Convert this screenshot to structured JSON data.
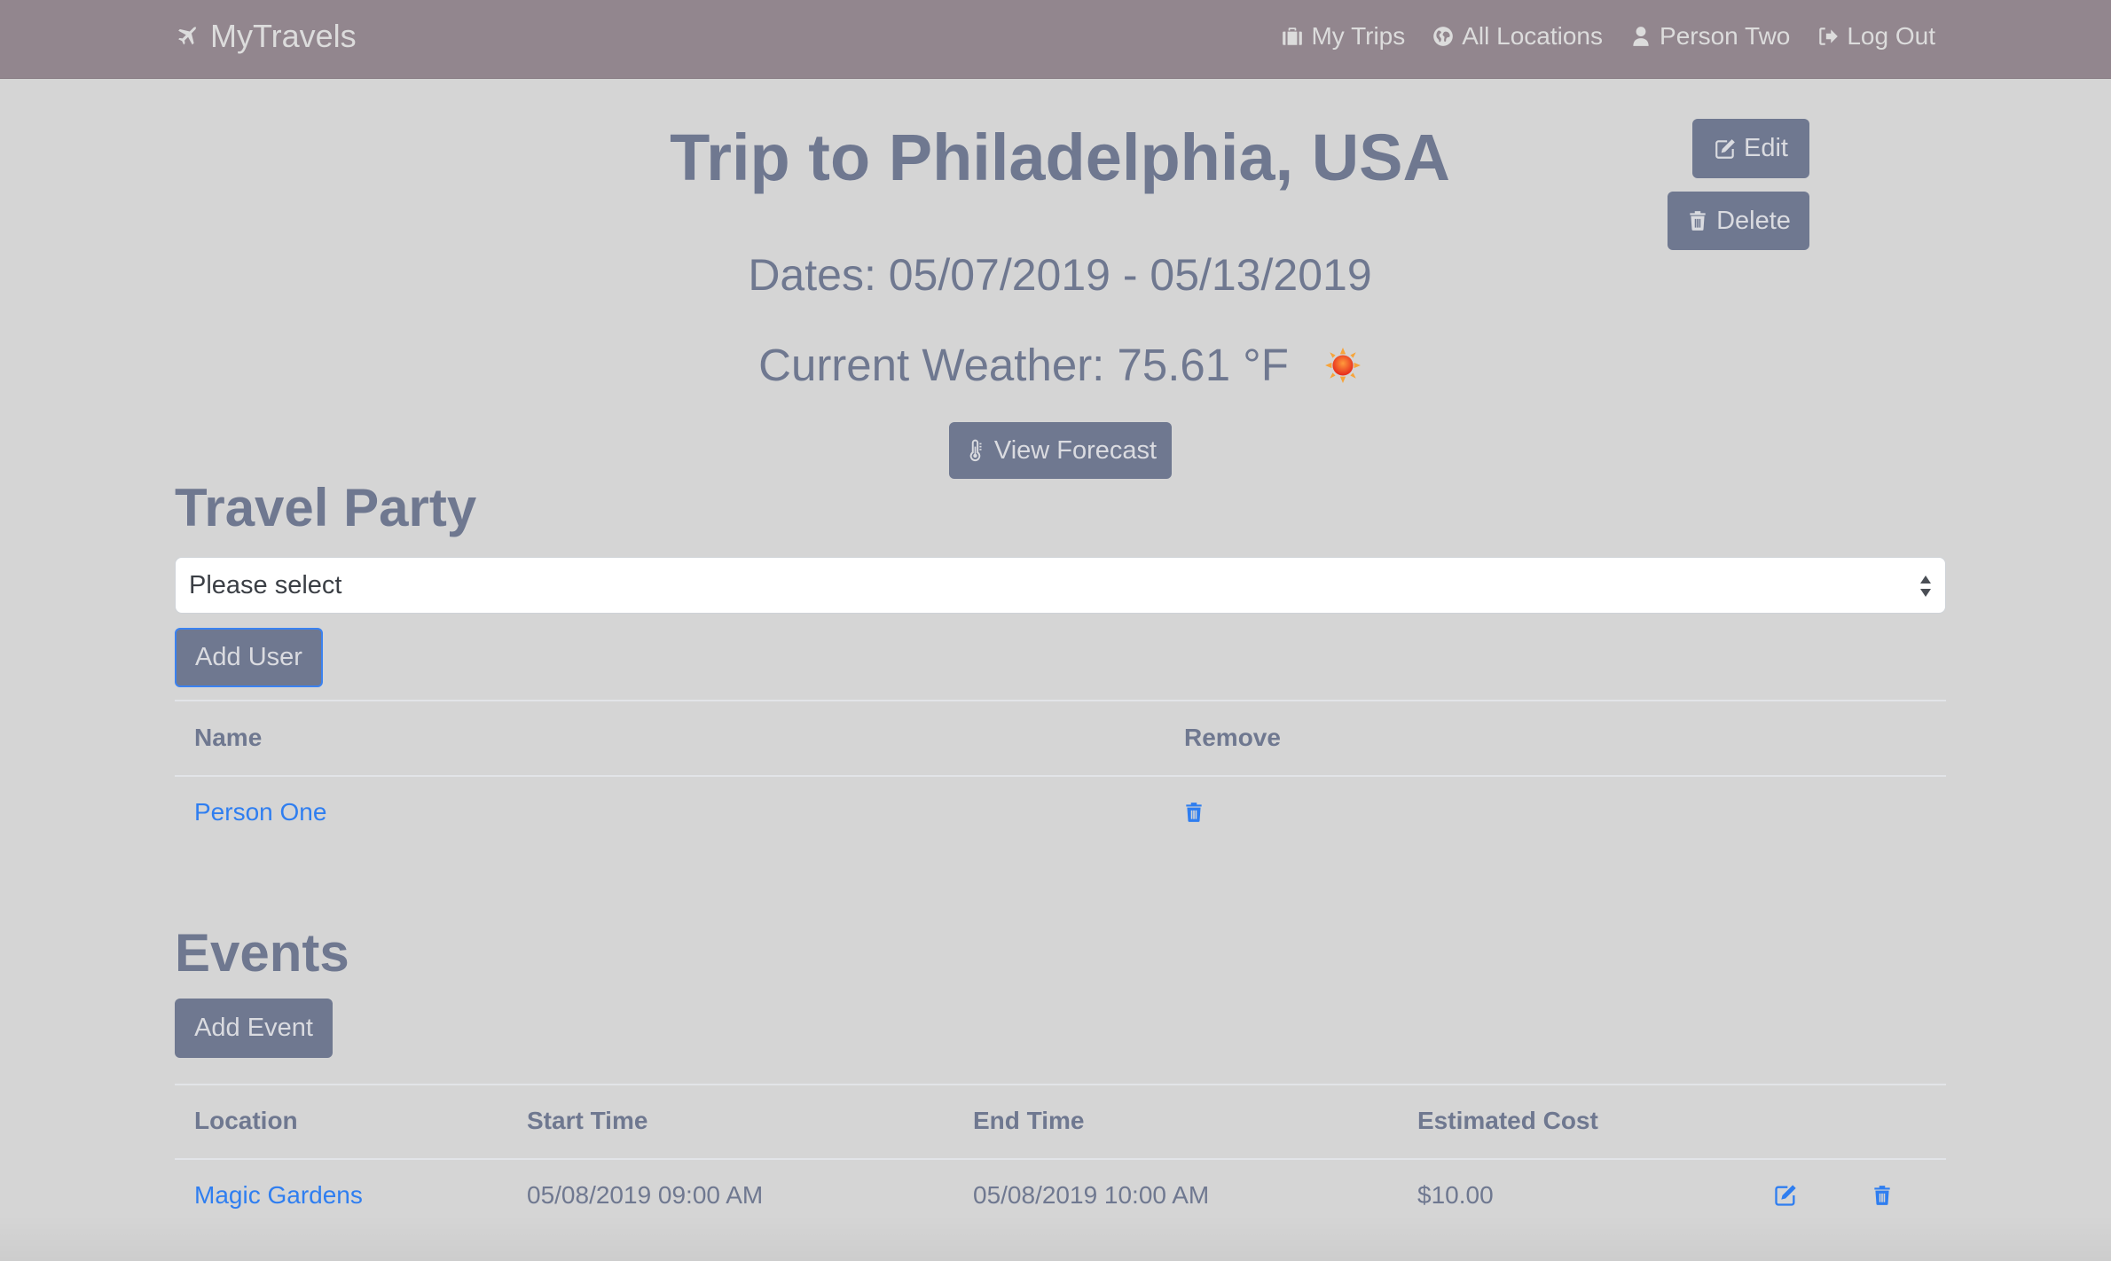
{
  "navbar": {
    "brand": "MyTravels",
    "brand_icon": "plane-icon",
    "links": [
      {
        "label": "My Trips",
        "icon": "briefcase-icon"
      },
      {
        "label": "All Locations",
        "icon": "globe-icon"
      },
      {
        "label": "Person Two",
        "icon": "user-icon"
      },
      {
        "label": "Log Out",
        "icon": "logout-icon"
      }
    ]
  },
  "trip": {
    "title": "Trip to Philadelphia, USA",
    "dates": "Dates: 05/07/2019 - 05/13/2019",
    "weather": "Current Weather: 75.61 °F",
    "weather_icon": "sun-icon"
  },
  "actions": {
    "edit_label": "Edit",
    "delete_label": "Delete",
    "forecast_label": "View Forecast"
  },
  "travel_party": {
    "heading": "Travel Party",
    "select_value": "Please select",
    "add_user_label": "Add User",
    "columns": [
      "Name",
      "Remove"
    ],
    "rows": [
      {
        "name": "Person One"
      }
    ]
  },
  "events": {
    "heading": "Events",
    "add_event_label": "Add Event",
    "columns": [
      "Location",
      "Start Time",
      "End Time",
      "Estimated Cost"
    ],
    "rows": [
      {
        "location": "Magic Gardens",
        "start": "05/08/2019 09:00 AM",
        "end": "05/08/2019 10:00 AM",
        "cost": "$10.00"
      }
    ]
  },
  "colors": {
    "navbar_bg": "#92868e",
    "page_bg": "#d5d5d5",
    "button_bg": "#6f7890",
    "text": "#6f7890",
    "link": "#2f7ef0"
  }
}
